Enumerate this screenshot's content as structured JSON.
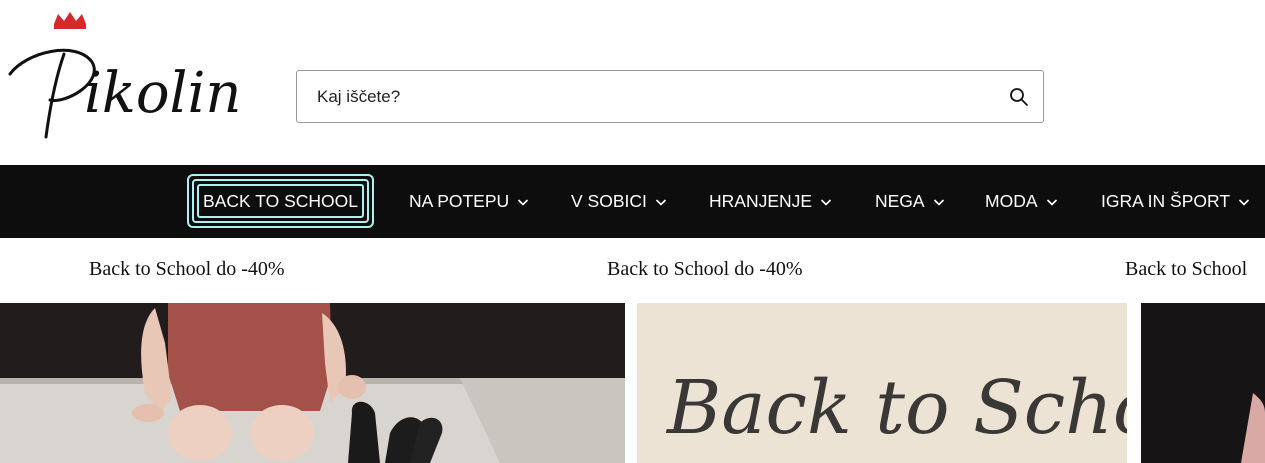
{
  "brand": {
    "logo_text": "Pikolin",
    "crown_color": "#d42a2a"
  },
  "search": {
    "placeholder": "Kaj iščete?",
    "icon": "search-icon"
  },
  "nav": {
    "items": [
      {
        "label": "BACK TO SCHOOL",
        "has_dropdown": false
      },
      {
        "label": "NA POTEPU",
        "has_dropdown": true
      },
      {
        "label": "V SOBICI",
        "has_dropdown": true
      },
      {
        "label": "HRANJENJE",
        "has_dropdown": true
      },
      {
        "label": "NEGA",
        "has_dropdown": true
      },
      {
        "label": "MODA",
        "has_dropdown": true
      },
      {
        "label": "IGRA IN ŠPORT",
        "has_dropdown": true
      }
    ],
    "highlight_color": "#aef0f0",
    "background": "#0d0d0d"
  },
  "promo": {
    "messages": [
      "Back to School do -40%",
      "Back to School do -40%",
      "Back to School"
    ]
  },
  "banners": {
    "center_script_text": "Back to School"
  }
}
